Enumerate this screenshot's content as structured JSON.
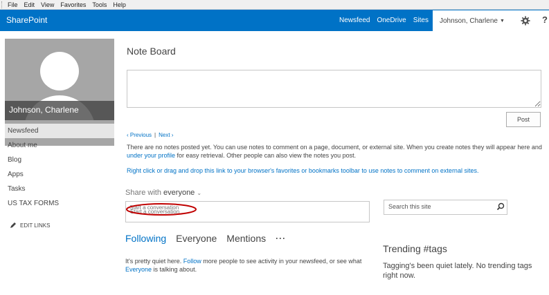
{
  "menubar": {
    "items": [
      "File",
      "Edit",
      "View",
      "Favorites",
      "Tools",
      "Help"
    ]
  },
  "suitebar": {
    "brand": "SharePoint",
    "nav": [
      "Newsfeed",
      "OneDrive",
      "Sites"
    ],
    "user": "Johnson, Charlene",
    "help": "?",
    "icons": {
      "settings": "gear-icon",
      "user_menu": "chevron-down-icon"
    }
  },
  "profile": {
    "name": "Johnson, Charlene"
  },
  "quicklaunch": {
    "items": [
      "Newsfeed",
      "About me",
      "Blog",
      "Apps",
      "Tasks",
      "US TAX FORMS"
    ],
    "selected": "Newsfeed",
    "edit_links": "EDIT LINKS"
  },
  "noteboard": {
    "title": "Note Board",
    "note_value": "",
    "post_label": "Post",
    "prev_label": "Previous",
    "next_label": "Next",
    "pager_sep": "|",
    "no_notes_part1": "There are no notes posted yet. You can use notes to comment on a page, document, or external site. When you create notes they will appear here and ",
    "no_notes_link": "under your profile",
    "no_notes_part2": " for easy retrieval. Other people can also view the notes you post.",
    "right_click_link": "Right click or drag and drop this link to your browser's favorites or bookmarks toolbar to use notes to comment on external sites."
  },
  "share": {
    "prefix": "Share with",
    "audience": "everyone",
    "placeholder": "Start a conversation"
  },
  "search": {
    "placeholder": "Search this site"
  },
  "feed": {
    "tabs": [
      "Following",
      "Everyone",
      "Mentions"
    ],
    "active_tab": "Following",
    "more": "···",
    "quiet_part1": "It's pretty quiet here. ",
    "quiet_link1": "Follow",
    "quiet_part2": " more people to see activity in your newsfeed, or see what ",
    "quiet_link2": "Everyone",
    "quiet_part3": " is talking about."
  },
  "trending": {
    "title": "Trending #tags",
    "text": "Tagging's been quiet lately. No trending tags right now."
  },
  "colors": {
    "suitebar": "#0072c6",
    "link": "#0072c6",
    "annotation": "#c00000"
  }
}
